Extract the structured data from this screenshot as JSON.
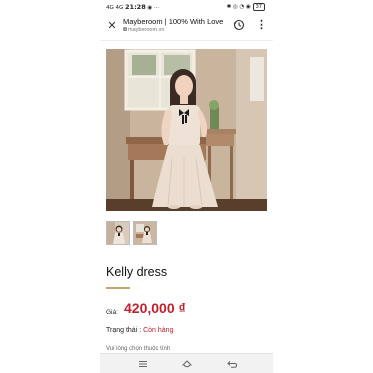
{
  "status_bar": {
    "left_text": "4G  4G",
    "time": "21:28",
    "right_text": "✱ ◎ ◔ ◉",
    "battery": "37"
  },
  "browser": {
    "title": "Mayberoom | 100% With Love",
    "url": "mayberoom.vn"
  },
  "product": {
    "name": "Kelly dress",
    "price_label": "Giá:",
    "price": "420,000 ₫",
    "status_label": "Trạng thái :",
    "status_value": "Còn hàng",
    "select_hint": "Vui lòng chọn thuộc tính"
  },
  "colors": {
    "price_red": "#c0212d",
    "accent_gold": "#c9a36b"
  },
  "icons": [
    "close-icon",
    "history-icon",
    "menu-dots-icon",
    "nav-menu-icon",
    "nav-home-icon",
    "nav-back-icon"
  ]
}
